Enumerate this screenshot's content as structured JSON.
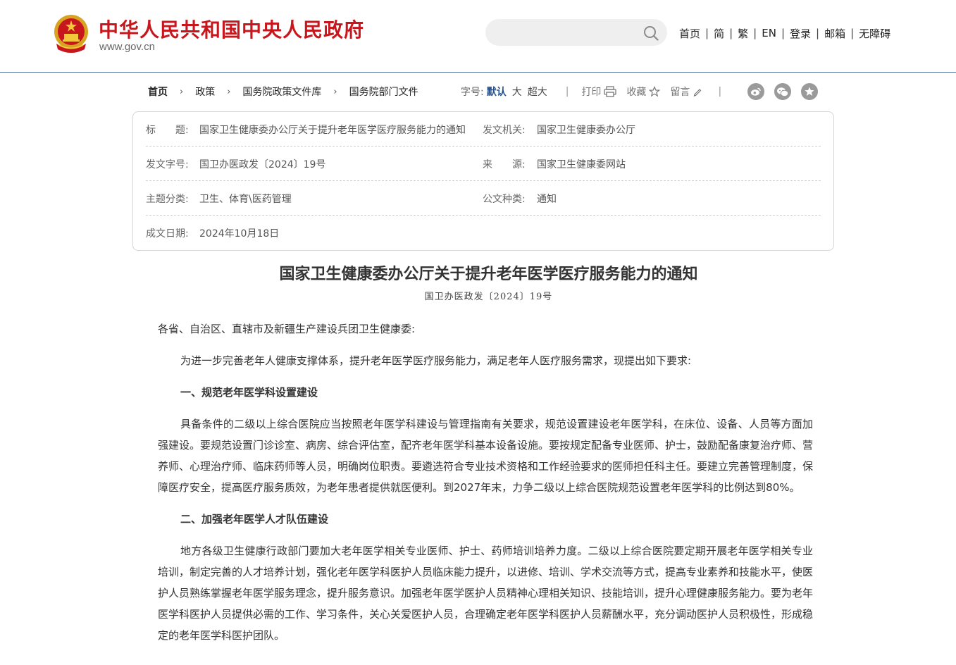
{
  "header": {
    "site_name": "中华人民共和国中央人民政府",
    "site_url": "www.gov.cn",
    "search_placeholder": "",
    "nav": [
      "首页",
      "简",
      "繁",
      "EN",
      "登录",
      "邮箱",
      "无障碍"
    ]
  },
  "breadcrumb": [
    "首页",
    "政策",
    "国务院政策文件库",
    "国务院部门文件"
  ],
  "tools": {
    "font_size_label": "字号:",
    "font_sizes": [
      "默认",
      "大",
      "超大"
    ],
    "print": "打印",
    "favorite": "收藏",
    "comment": "留言",
    "share_icons": [
      "weibo-icon",
      "wechat-icon",
      "star-icon"
    ]
  },
  "info": {
    "title_label": "标　　题:",
    "title_value": "国家卫生健康委办公厅关于提升老年医学医疗服务能力的通知",
    "issuer_label": "发文机关:",
    "issuer_value": "国家卫生健康委办公厅",
    "docno_label": "发文字号:",
    "docno_value": "国卫办医政发〔2024〕19号",
    "source_label": "来　　源:",
    "source_value": "国家卫生健康委网站",
    "topic_label": "主题分类:",
    "topic_value": "卫生、体育\\医药管理",
    "type_label": "公文种类:",
    "type_value": "通知",
    "date_label": "成文日期:",
    "date_value": "2024年10月18日"
  },
  "article": {
    "title": "国家卫生健康委办公厅关于提升老年医学医疗服务能力的通知",
    "doc_no": "国卫办医政发〔2024〕19号",
    "salutation": "各省、自治区、直辖市及新疆生产建设兵团卫生健康委:",
    "intro": "为进一步完善老年人健康支撑体系，提升老年医学医疗服务能力，满足老年人医疗服务需求，现提出如下要求:",
    "section1_title": "一、规范老年医学科设置建设",
    "section1_body": "具备条件的二级以上综合医院应当按照老年医学科建设与管理指南有关要求，规范设置建设老年医学科，在床位、设备、人员等方面加强建设。要规范设置门诊诊室、病房、综合评估室，配齐老年医学科基本设备设施。要按规定配备专业医师、护士，鼓励配备康复治疗师、营养师、心理治疗师、临床药师等人员，明确岗位职责。要遴选符合专业技术资格和工作经验要求的医师担任科主任。要建立完善管理制度，保障医疗安全，提高医疗服务质效，为老年患者提供就医便利。到2027年末，力争二级以上综合医院规范设置老年医学科的比例达到80%。",
    "section2_title": "二、加强老年医学人才队伍建设",
    "section2_body": "地方各级卫生健康行政部门要加大老年医学相关专业医师、护士、药师培训培养力度。二级以上综合医院要定期开展老年医学相关专业培训，制定完善的人才培养计划，强化老年医学科医护人员临床能力提升，以进修、培训、学术交流等方式，提高专业素养和技能水平，使医护人员熟练掌握老年医学服务理念，提升服务意识。加强老年医学医护人员精神心理相关知识、技能培训，提升心理健康服务能力。要为老年医学科医护人员提供必需的工作、学习条件，关心关爱医护人员，合理确定老年医学科医护人员薪酬水平，充分调动医护人员积极性，形成稳定的老年医学科医护团队。"
  },
  "colors": {
    "brand_red": "#c8161d",
    "header_rule": "#4a6aa0",
    "active_size": "#23508f",
    "share_icon_bg": "#9a9a9a"
  }
}
